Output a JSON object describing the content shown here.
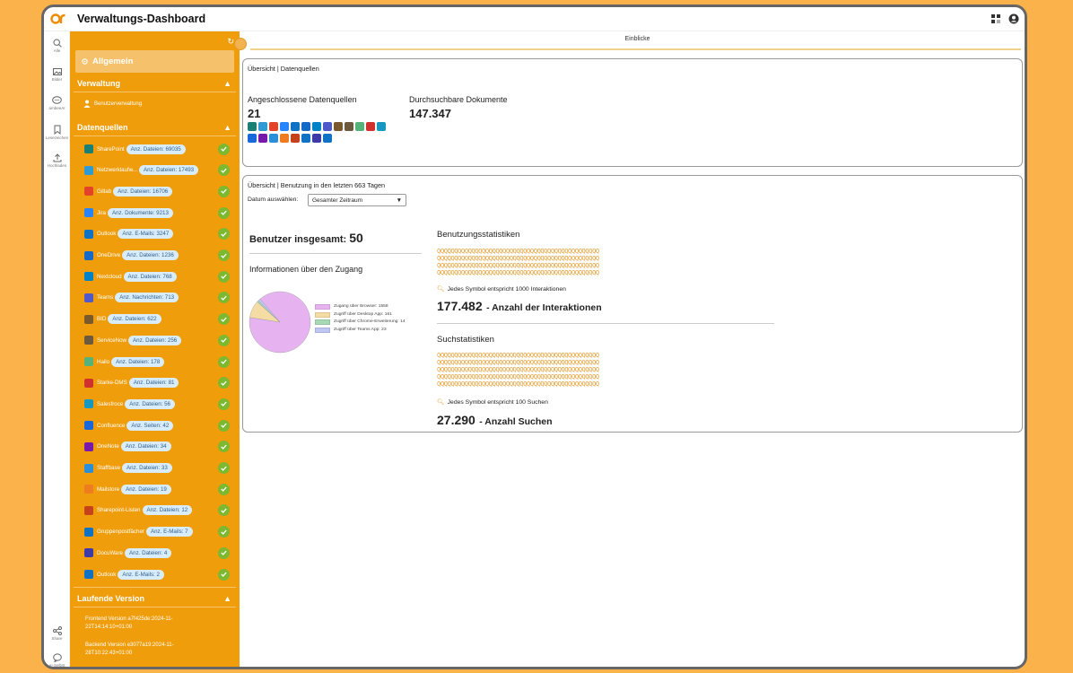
{
  "app": {
    "title": "Verwaltungs-Dashboard"
  },
  "rail": [
    {
      "icon": "search-icon",
      "label": "Alle"
    },
    {
      "icon": "image-icon",
      "label": "Bilder"
    },
    {
      "icon": "chat-icon",
      "label": "ambeeAI"
    },
    {
      "icon": "bookmark-icon",
      "label": "Lesezeichen"
    },
    {
      "icon": "upload-icon",
      "label": "Hochladen"
    },
    {
      "icon": "share-icon",
      "label": "Share"
    },
    {
      "icon": "chat-bubble-icon",
      "label": "Ai-Selbst"
    }
  ],
  "sidebar": {
    "general_label": "Allgemein",
    "admin_section": "Verwaltung",
    "user_admin": "Benutzerverwaltung",
    "datasources_section": "Datenquellen",
    "datasources": [
      {
        "name": "SharePoint",
        "badge": "Anz. Dateien: 69035",
        "color": "#1a7f74"
      },
      {
        "name": "Netzwerklaufw...",
        "badge": "Anz. Dateien: 17493",
        "color": "#2f9ad3"
      },
      {
        "name": "Gitlab",
        "badge": "Anz. Dateien: 16706",
        "color": "#e24329"
      },
      {
        "name": "Jira",
        "badge": "Anz. Dokumente: 9213",
        "color": "#2684ff"
      },
      {
        "name": "Outlook",
        "badge": "Anz. E-Mails: 3247",
        "color": "#0f72c4"
      },
      {
        "name": "OneDrive",
        "badge": "Anz. Dateien: 1236",
        "color": "#1569c7"
      },
      {
        "name": "Nextcloud",
        "badge": "Anz. Dateien: 768",
        "color": "#0082c9"
      },
      {
        "name": "Teams",
        "badge": "Anz. Nachrichten: 713",
        "color": "#5059c9"
      },
      {
        "name": "BID",
        "badge": "Anz. Dateien: 622",
        "color": "#7a5a2d"
      },
      {
        "name": "ServiceNow",
        "badge": "Anz. Dateien: 256",
        "color": "#6d5a3e"
      },
      {
        "name": "Hailo",
        "badge": "Anz. Dateien: 178",
        "color": "#55b37a"
      },
      {
        "name": "Starke-DMS",
        "badge": "Anz. Dateien: 81",
        "color": "#d0312d"
      },
      {
        "name": "Salesfroce",
        "badge": "Anz. Dateien: 56",
        "color": "#1798c1"
      },
      {
        "name": "Confluence",
        "badge": "Anz. Seiten: 42",
        "color": "#1868db"
      },
      {
        "name": "OneNote",
        "badge": "Anz. Dateien: 34",
        "color": "#7719aa"
      },
      {
        "name": "Staffbase",
        "badge": "Anz. Dateien: 33",
        "color": "#2a8fd6"
      },
      {
        "name": "Mailstore",
        "badge": "Anz. Dateien: 19",
        "color": "#f07c20"
      },
      {
        "name": "Sharepoint-Listen",
        "badge": "Anz. Dateien: 12",
        "color": "#c6421b"
      },
      {
        "name": "Gruppenpostfächer",
        "badge": "Anz. E-Mails: 7",
        "color": "#0f72c4"
      },
      {
        "name": "DocuWare",
        "badge": "Anz. Dateien: 4",
        "color": "#3d3ba8"
      },
      {
        "name": "Outlook",
        "badge": "Anz. E-Mails: 2",
        "color": "#0f72c4"
      }
    ],
    "version_section": "Laufende Version",
    "frontend_version": "Frontend Version a7f425de:2024-11-22T14:14:10+01:00",
    "backend_version": "Backend Version e3077a19:2024-11-28T10:22:43+01:00"
  },
  "content": {
    "header": "Einblicke",
    "overview_sources": {
      "title": "Übersicht | Datenquellen",
      "connected_label": "Angeschlossene Datenquellen",
      "connected_value": "21",
      "docs_label": "Durchsuchbare Dokumente",
      "docs_value": "147.347",
      "icon_colors": [
        "#1a7f74",
        "#2f9ad3",
        "#e24329",
        "#2684ff",
        "#0f72c4",
        "#1569c7",
        "#0082c9",
        "#5059c9",
        "#7a5a2d",
        "#6d5a3e",
        "#55b37a",
        "#d0312d",
        "#1798c1",
        "#1868db",
        "#7719aa",
        "#2a8fd6",
        "#f07c20",
        "#c6421b",
        "#0f72c4",
        "#3d3ba8",
        "#0f72c4"
      ]
    },
    "usage": {
      "title": "Übersicht | Benutzung in den letzten 663 Tagen",
      "date_label": "Datum auswählen:",
      "date_value": "Gesamter Zeitraum",
      "users_label": "Benutzer insgesamt:",
      "users_value": "50",
      "access_title": "Informationen über den Zugang",
      "usage_stats_title": "Benutzungsstatistiken",
      "interactions_note": "Jedes Symbol entspricht 1000 Interaktionen",
      "interactions_value": "177.482",
      "interactions_label": "- Anzahl der Interaktionen",
      "search_stats_title": "Suchstatistiken",
      "search_note": "Jedes Symbol entspricht 100 Suchen",
      "search_value": "27.290",
      "search_label": "- Anzahl Suchen",
      "symbol_color": "#e2a23b"
    }
  },
  "chart_data": {
    "type": "pie",
    "title": "",
    "slices": [
      {
        "label": "Zugang über Browser: 1558",
        "value": 1558,
        "color": "#e6b3f0"
      },
      {
        "label": "Zugriff über Desktop App: 161",
        "value": 161,
        "color": "#f5dca4"
      },
      {
        "label": "Zugriff über Chrome-Erweiterung: 14",
        "value": 14,
        "color": "#a8d8b4"
      },
      {
        "label": "Zugriff über Teams App: 23",
        "value": 23,
        "color": "#c0c6f3"
      }
    ],
    "legend_position": "right"
  }
}
